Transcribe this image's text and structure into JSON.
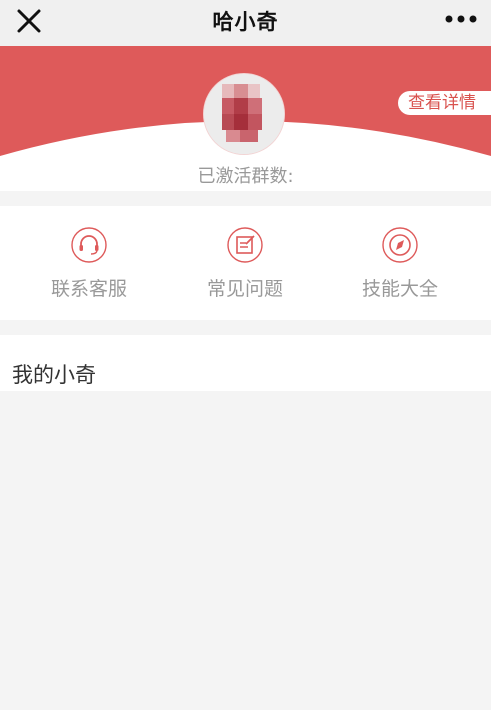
{
  "header": {
    "title": "哈小奇",
    "close_icon": "close-icon",
    "more_icon": "more-dots-icon"
  },
  "hero": {
    "detail_button": "查看详情",
    "group_count_label": "已激活群数:",
    "accent_color": "#de5a5a"
  },
  "quick_links": [
    {
      "label": "联系客服",
      "icon": "headset-icon"
    },
    {
      "label": "常见问题",
      "icon": "edit-note-icon"
    },
    {
      "label": "技能大全",
      "icon": "compass-icon"
    }
  ],
  "my_section": {
    "title": "我的小奇"
  }
}
